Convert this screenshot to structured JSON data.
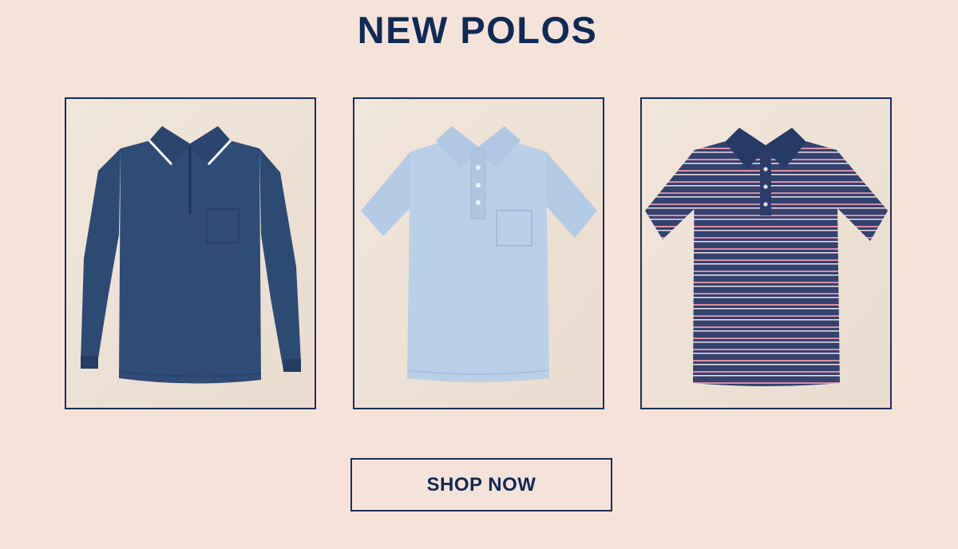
{
  "header": {
    "title": "NEW POLOS"
  },
  "products": [
    {
      "name": "navy-long-sleeve-polo",
      "garment_color": "#2b4670",
      "accent_color": "#ffffff"
    },
    {
      "name": "light-blue-short-sleeve-polo",
      "garment_color": "#b7cde6",
      "accent_color": "#a7bfdb"
    },
    {
      "name": "navy-pink-striped-polo",
      "garment_color": "#33426f",
      "accent_color": "#d98ea0"
    }
  ],
  "cta": {
    "label": "SHOP NOW"
  },
  "colors": {
    "background": "#f5e3da",
    "brand_navy": "#0f2a55",
    "card_background": "#eee1d4"
  }
}
